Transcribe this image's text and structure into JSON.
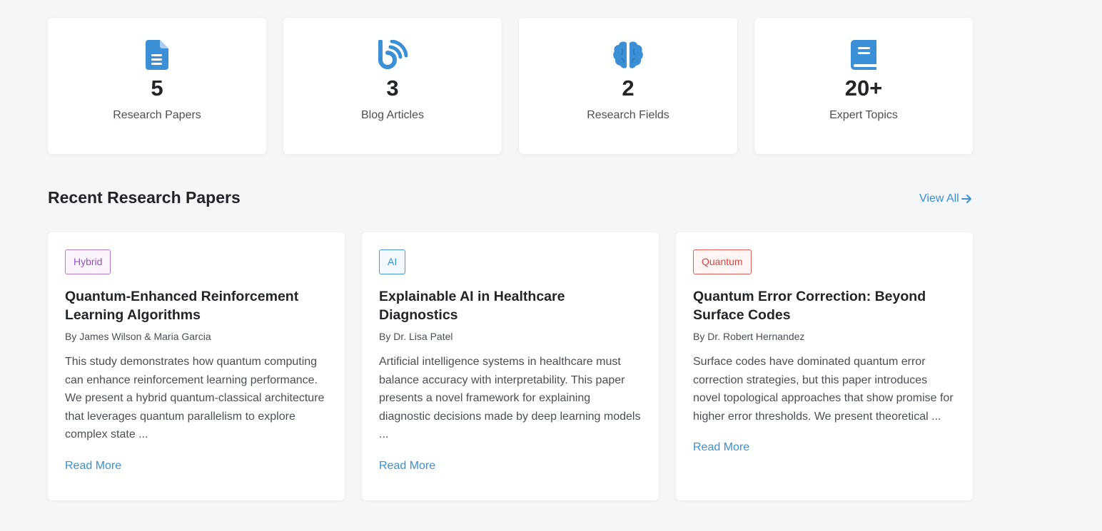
{
  "stats": [
    {
      "icon": "document-icon",
      "value": "5",
      "label": "Research Papers"
    },
    {
      "icon": "blog-icon",
      "value": "3",
      "label": "Blog Articles"
    },
    {
      "icon": "brain-icon",
      "value": "2",
      "label": "Research Fields"
    },
    {
      "icon": "book-icon",
      "value": "20+",
      "label": "Expert Topics"
    }
  ],
  "section": {
    "title": "Recent Research Papers",
    "view_all": "View All"
  },
  "papers": [
    {
      "tag": "Hybrid",
      "title": "Quantum-Enhanced Reinforcement Learning Algorithms",
      "authors": "By James Wilson & Maria Garcia",
      "abstract": "This study demonstrates how quantum computing can enhance reinforcement learning performance. We present a hybrid quantum-classical architecture that leverages quantum parallelism to explore complex state ...",
      "read_more": "Read More"
    },
    {
      "tag": "AI",
      "title": "Explainable AI in Healthcare Diagnostics",
      "authors": "By Dr. Lisa Patel",
      "abstract": "Artificial intelligence systems in healthcare must balance accuracy with interpretability. This paper presents a novel framework for explaining diagnostic decisions made by deep learning models ...",
      "read_more": "Read More"
    },
    {
      "tag": "Quantum",
      "title": "Quantum Error Correction: Beyond Surface Codes",
      "authors": "By Dr. Robert Hernandez",
      "abstract": "Surface codes have dominated quantum error correction strategies, but this paper introduces novel topological approaches that show promise for higher error thresholds. We present theoretical ...",
      "read_more": "Read More"
    }
  ],
  "colors": {
    "accent": "#3a8fd6",
    "hybrid": "#9b4fbf",
    "ai": "#3a8fd6",
    "quantum": "#d9443c"
  }
}
